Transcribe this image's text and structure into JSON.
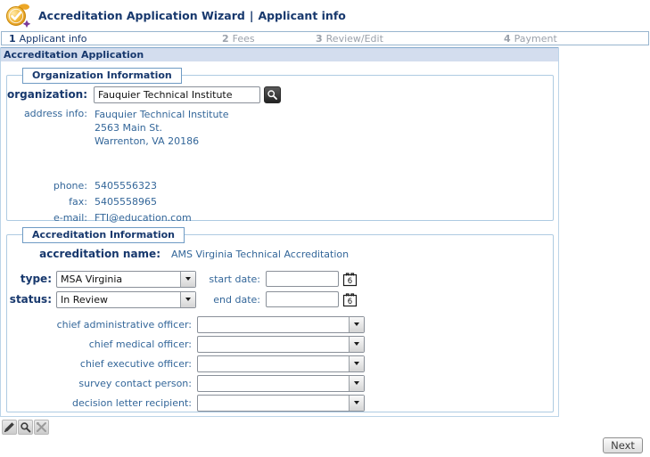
{
  "header": {
    "title": "Accreditation Application Wizard",
    "separator": "|",
    "context": "Applicant info"
  },
  "steps": [
    {
      "number": "1",
      "label": "Applicant info",
      "active": true
    },
    {
      "number": "2",
      "label": "Fees",
      "active": false
    },
    {
      "number": "3",
      "label": "Review/Edit",
      "active": false
    },
    {
      "number": "4",
      "label": "Payment",
      "active": false
    }
  ],
  "panel": {
    "title": "Accreditation Application"
  },
  "organization_section": {
    "legend": "Organization Information",
    "organization_label": "organization:",
    "organization_value": "Fauquier Technical Institute",
    "address_label": "address info:",
    "address_lines": [
      "Fauquier Technical Institute",
      "2563 Main St.",
      "Warrenton, VA 20186"
    ],
    "phone_label": "phone:",
    "phone_value": "5405556323",
    "fax_label": "fax:",
    "fax_value": "5405558965",
    "email_label": "e-mail:",
    "email_value": "FTI@education.com"
  },
  "accreditation_section": {
    "legend": "Accreditation Information",
    "name_label": "accreditation name:",
    "name_value": "AMS Virginia Technical Accreditation",
    "type_label": "type:",
    "type_value": "MSA Virginia",
    "status_label": "status:",
    "status_value": "In Review",
    "start_date_label": "start date:",
    "start_date_value": "",
    "end_date_label": "end date:",
    "end_date_value": "",
    "calendar_day": "6",
    "officer_fields": [
      {
        "label": "chief administrative officer:",
        "value": ""
      },
      {
        "label": "chief medical officer:",
        "value": ""
      },
      {
        "label": "chief executive officer:",
        "value": ""
      },
      {
        "label": "survey contact person:",
        "value": ""
      },
      {
        "label": "decision letter recipient:",
        "value": ""
      }
    ]
  },
  "toolbar": {
    "icons": [
      "edit-pencil",
      "magnifier",
      "tools"
    ]
  },
  "footer": {
    "next_label": "Next"
  },
  "colors": {
    "navy": "#17386d",
    "label_blue": "#336699",
    "band_bg": "#d3ddee",
    "panel_border": "#bcd4e8",
    "legend_border": "#6f9bc4",
    "step_inactive": "#9aa1ab",
    "badge_gold": "#eda726",
    "badge_purple": "#7a3a9a"
  }
}
